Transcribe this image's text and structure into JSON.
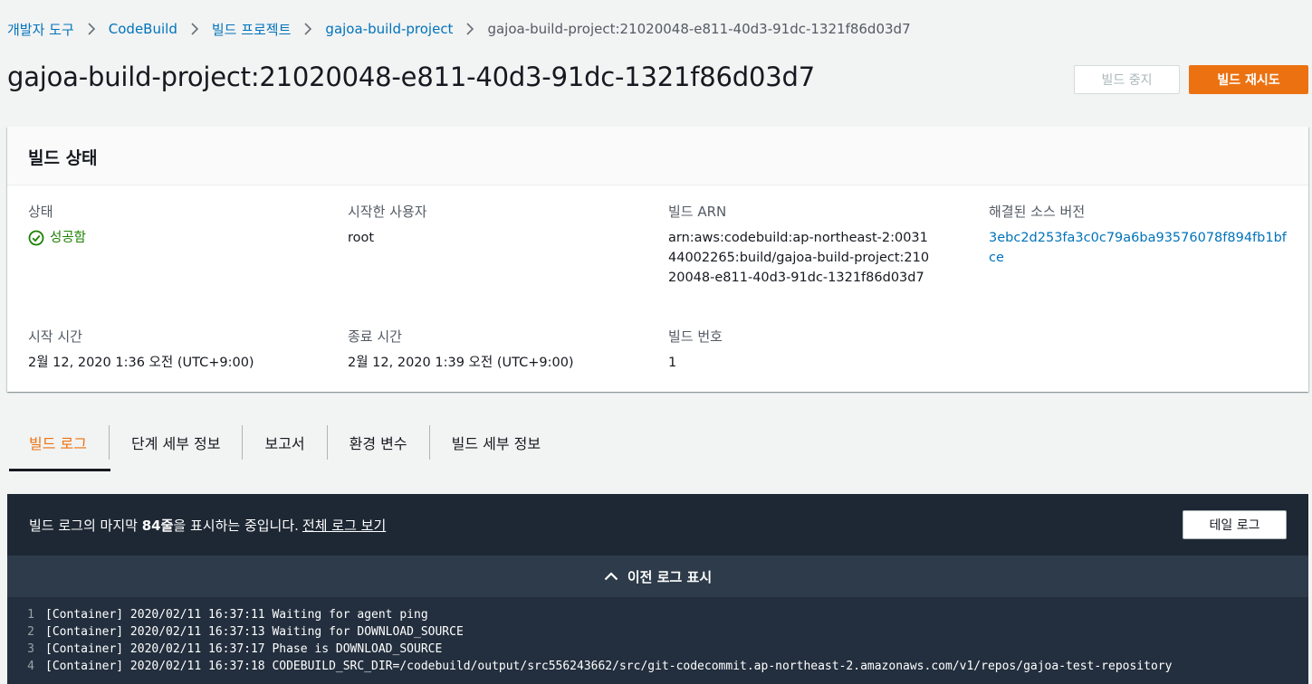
{
  "breadcrumb": {
    "items": [
      "개발자 도구",
      "CodeBuild",
      "빌드 프로젝트",
      "gajoa-build-project"
    ],
    "current": "gajoa-build-project:21020048-e811-40d3-91dc-1321f86d03d7"
  },
  "page": {
    "title": "gajoa-build-project:21020048-e811-40d3-91dc-1321f86d03d7",
    "stop_button": "빌드 중지",
    "retry_button": "빌드 재시도"
  },
  "status_card": {
    "title": "빌드 상태",
    "status_label": "상태",
    "status_value": "성공함",
    "initiator_label": "시작한 사용자",
    "initiator_value": "root",
    "arn_label": "빌드 ARN",
    "arn_value": "arn:aws:codebuild:ap-northeast-2:003144002265:build/gajoa-build-project:21020048-e811-40d3-91dc-1321f86d03d7",
    "source_label": "해결된 소스 버전",
    "source_value": "3ebc2d253fa3c0c79a6ba93576078f894fb1bfce",
    "start_label": "시작 시간",
    "start_value": "2월 12, 2020 1:36 오전 (UTC+9:00)",
    "end_label": "종료 시간",
    "end_value": "2월 12, 2020 1:39 오전 (UTC+9:00)",
    "number_label": "빌드 번호",
    "number_value": "1"
  },
  "tabs": [
    "빌드 로그",
    "단계 세부 정보",
    "보고서",
    "환경 변수",
    "빌드 세부 정보"
  ],
  "log": {
    "header_prefix": "빌드 로그의 마지막 ",
    "header_count": "84줄",
    "header_suffix": "을 표시하는 중입니다.",
    "full_log_link": "전체 로그 보기",
    "tail_button": "테일 로그",
    "show_previous": "이전 로그 표시",
    "lines": [
      {
        "n": "1",
        "text": "[Container] 2020/02/11 16:37:11 Waiting for agent ping"
      },
      {
        "n": "2",
        "text": "[Container] 2020/02/11 16:37:13 Waiting for DOWNLOAD_SOURCE"
      },
      {
        "n": "3",
        "text": "[Container] 2020/02/11 16:37:17 Phase is DOWNLOAD_SOURCE"
      },
      {
        "n": "4",
        "text": "[Container] 2020/02/11 16:37:18 CODEBUILD_SRC_DIR=/codebuild/output/src556243662/src/git-codecommit.ap-northeast-2.amazonaws.com/v1/repos/gajoa-test-repository"
      }
    ]
  }
}
